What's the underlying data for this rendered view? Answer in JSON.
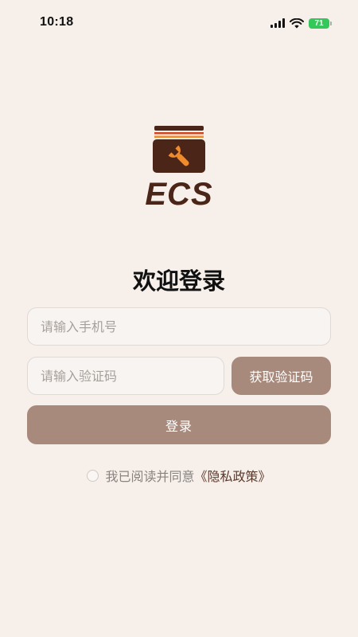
{
  "status_bar": {
    "time": "10:18",
    "battery": "71",
    "icons": [
      "signal-icon",
      "wifi-icon",
      "battery-icon"
    ]
  },
  "logo": {
    "text": "ECS",
    "icon": "toolbox-wrench-icon"
  },
  "welcome": {
    "title": "欢迎登录"
  },
  "form": {
    "phone_placeholder": "请输入手机号",
    "code_placeholder": "请输入验证码",
    "get_code_label": "获取验证码",
    "login_label": "登录"
  },
  "agreement": {
    "checked": false,
    "text": "我已阅读并同意",
    "policy_link": "《隐私政策》"
  },
  "colors": {
    "background": "#f6efea",
    "button": "#a88a7c",
    "brand_dark": "#4a2518",
    "brand_orange": "#f08a2b",
    "battery": "#34c759"
  }
}
